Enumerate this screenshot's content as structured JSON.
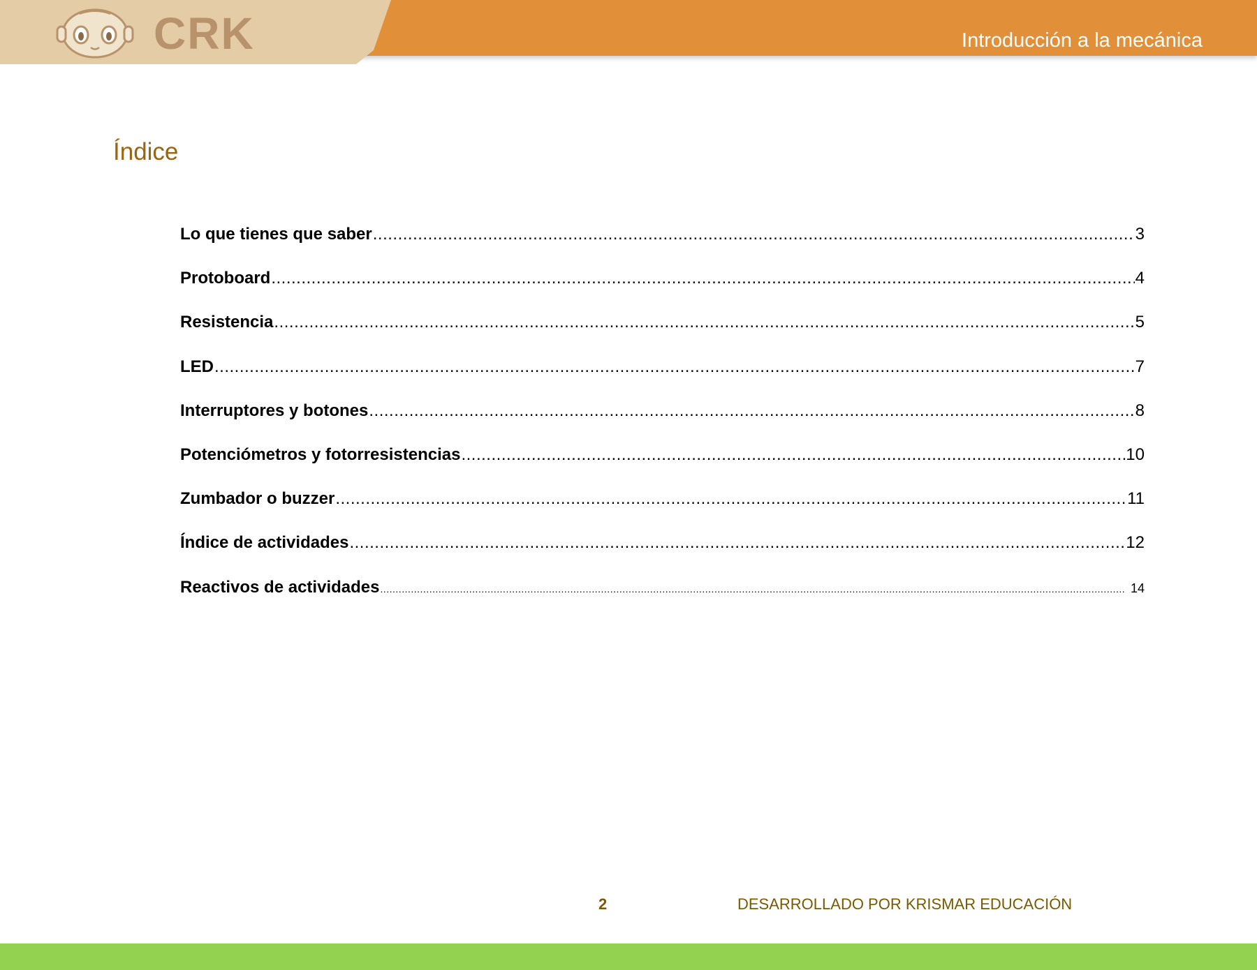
{
  "header": {
    "logo_text": "CRK",
    "title": "Introducción a la mecánica"
  },
  "page_title": "Índice",
  "toc": [
    {
      "label": "Lo que tienes que saber",
      "page": "3"
    },
    {
      "label": "Protoboard",
      "page": "4"
    },
    {
      "label": "Resistencia",
      "page": "5"
    },
    {
      "label": "LED",
      "page": "7"
    },
    {
      "label": "Interruptores y botones",
      "page": "8"
    },
    {
      "label": "Potenciómetros y fotorresistencias",
      "page": "10"
    },
    {
      "label": "Zumbador o buzzer",
      "page": "11"
    },
    {
      "label": "Índice de actividades",
      "page": "12"
    },
    {
      "label": "Reactivos de actividades",
      "page": "14"
    }
  ],
  "footer": {
    "page_number": "2",
    "credit": "DESARROLLADO POR KRISMAR EDUCACIÓN"
  },
  "colors": {
    "header_orange": "#e18f38",
    "logo_panel": "#e4cca6",
    "title_brown": "#9a6412",
    "footer_text": "#7a5a00",
    "footer_green": "#93d151"
  },
  "icons": {
    "logo_mascot": "robot-face-icon"
  }
}
